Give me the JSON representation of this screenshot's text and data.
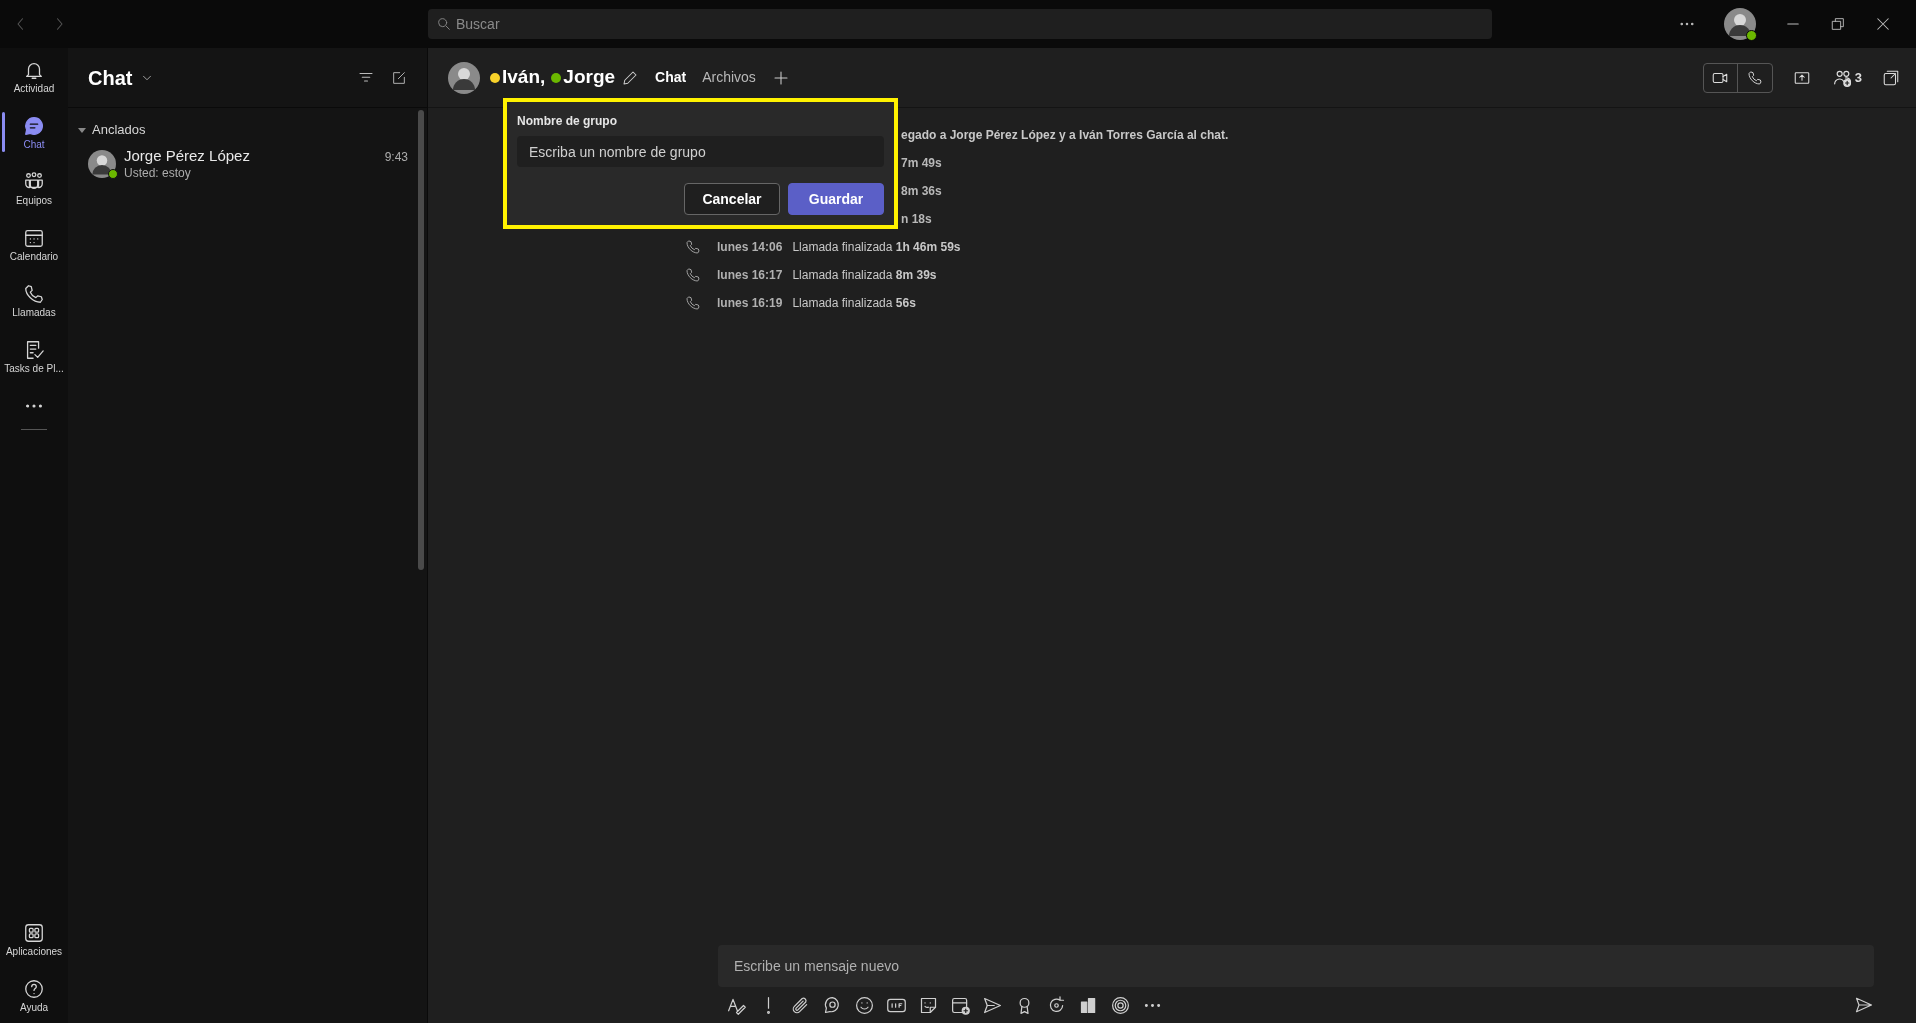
{
  "title_bar": {
    "search": {
      "placeholder": "Buscar"
    }
  },
  "rail": {
    "items": [
      {
        "label": "Actividad",
        "selected": false
      },
      {
        "label": "Chat",
        "selected": true
      },
      {
        "label": "Equipos",
        "selected": false
      },
      {
        "label": "Calendario",
        "selected": false
      },
      {
        "label": "Llamadas",
        "selected": false
      },
      {
        "label": "Tasks de Pl...",
        "selected": false
      }
    ],
    "bottom_items": [
      {
        "label": "Aplicaciones"
      },
      {
        "label": "Ayuda"
      }
    ]
  },
  "chat_list": {
    "title": "Chat",
    "section": {
      "label": "Anclados",
      "expanded": true
    },
    "items": [
      {
        "name": "Jorge Pérez López",
        "preview": "Usted: estoy",
        "time": "9:43",
        "color": "#6bb700"
      }
    ]
  },
  "conversation": {
    "participants": [
      {
        "name": "Iván,",
        "color": "#f8d22a"
      },
      {
        "name": "Jorge",
        "color": "#6bb700"
      }
    ],
    "tabs": [
      {
        "label": "Chat",
        "selected": true
      },
      {
        "label": "Archivos",
        "selected": false
      }
    ],
    "people_count": "3",
    "messages": [
      {
        "kind": "system",
        "text": "egado a Jorge Pérez López y a Iván Torres García al chat."
      },
      {
        "kind": "call",
        "text": "7m 49s"
      },
      {
        "kind": "call",
        "text": "8m 36s"
      },
      {
        "kind": "call",
        "text": "n 18s"
      },
      {
        "kind": "call",
        "time": "lunes 14:06",
        "text": "Llamada finalizada **1h 46m 59s**"
      },
      {
        "kind": "call",
        "time": "lunes 16:17",
        "text": "Llamada finalizada **8m 39s**"
      },
      {
        "kind": "call",
        "time": "lunes 16:19",
        "text": "Llamada finalizada **56s**"
      }
    ],
    "composer": {
      "placeholder": "Escribe un mensaje nuevo"
    }
  },
  "group_name_popup": {
    "label": "Nombre de grupo",
    "placeholder": "Escriba un nombre de grupo",
    "buttons": [
      {
        "label": "Cancelar",
        "kind": "secondary"
      },
      {
        "label": "Guardar",
        "kind": "primary"
      }
    ]
  }
}
